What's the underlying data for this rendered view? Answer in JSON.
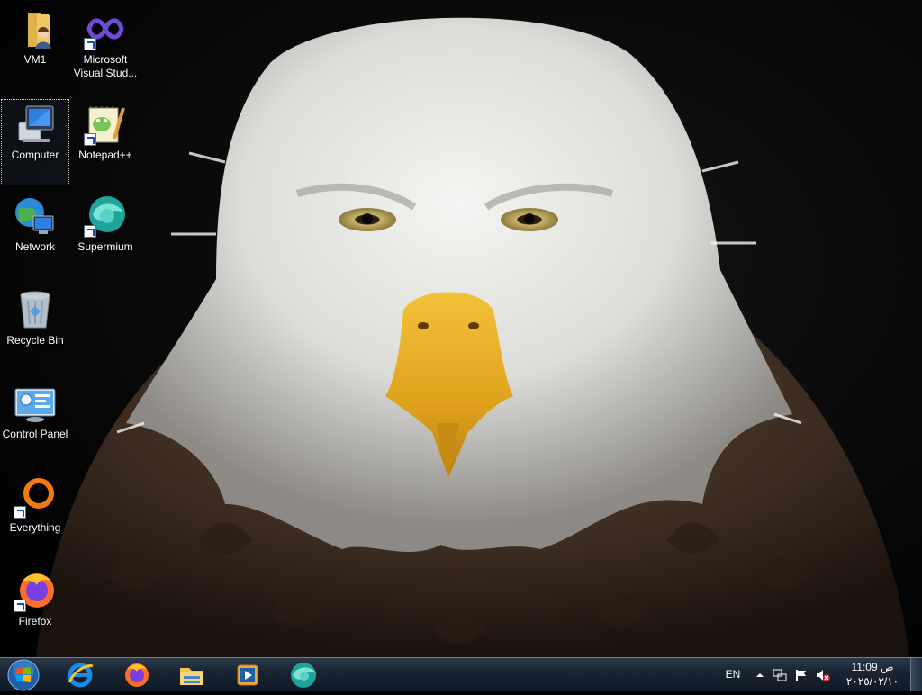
{
  "desktop": {
    "icons": [
      {
        "label": "VM1",
        "glyph": "user-folder-icon"
      },
      {
        "label": "Microsoft Visual Stud...",
        "glyph": "visual-studio-icon",
        "shortcut": true
      },
      {
        "label": "Computer",
        "glyph": "computer-icon",
        "selected": true
      },
      {
        "label": "Notepad++",
        "glyph": "notepad-plus-plus-icon",
        "shortcut": true
      },
      {
        "label": "Network",
        "glyph": "network-icon"
      },
      {
        "label": "Supermium",
        "glyph": "supermium-icon",
        "shortcut": true
      },
      {
        "label": "Recycle Bin",
        "glyph": "recycle-bin-icon"
      },
      {
        "label": "Control Panel",
        "glyph": "control-panel-icon"
      },
      {
        "label": "Everything",
        "glyph": "everything-search-icon",
        "shortcut": true
      },
      {
        "label": "Firefox",
        "glyph": "firefox-icon",
        "shortcut": true
      }
    ]
  },
  "taskbar": {
    "pinned": [
      {
        "name": "internet-explorer-icon"
      },
      {
        "name": "firefox-icon"
      },
      {
        "name": "file-explorer-icon"
      },
      {
        "name": "media-player-icon"
      },
      {
        "name": "supermium-icon"
      }
    ],
    "tray": {
      "language": "EN",
      "time": "ص 11:09",
      "date": "٢٠٢٥/٠٢/١٠"
    }
  },
  "colors": {
    "taskbar": "#1a2533",
    "accent": "#1c4fb8"
  }
}
